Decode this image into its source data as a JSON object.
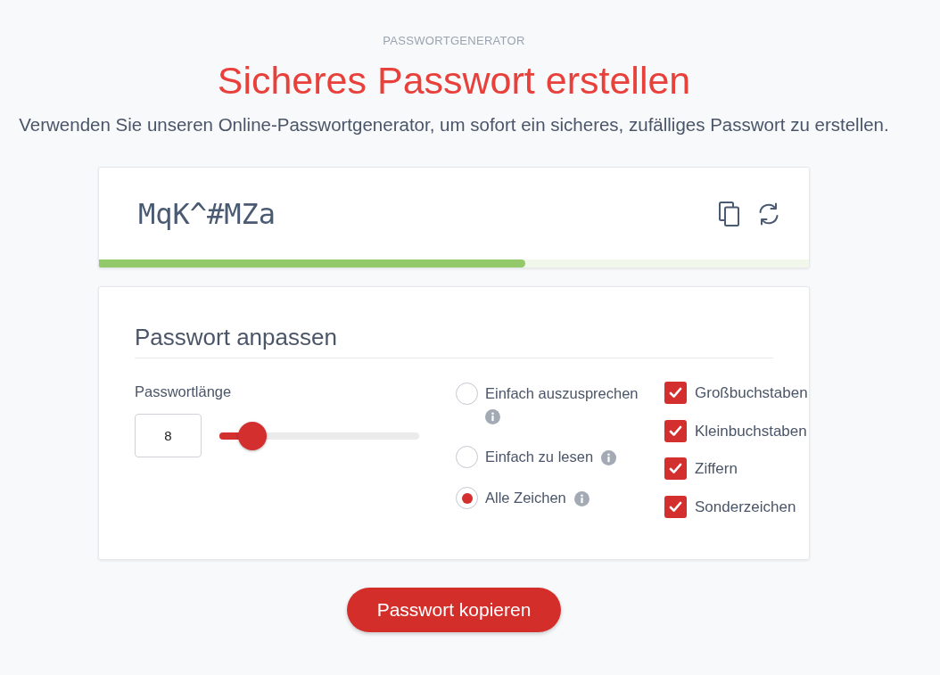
{
  "header": {
    "eyebrow": "PASSWORTGENERATOR",
    "title": "Sicheres Passwort erstellen",
    "subtitle": "Verwenden Sie unseren Online-Passwortgenerator, um sofort ein sicheres, zufälliges Passwort zu erstellen."
  },
  "password_card": {
    "password": "MqK^#MZa",
    "strength": {
      "level": 0.6
    }
  },
  "settings": {
    "title": "Passwort anpassen",
    "length": {
      "label": "Passwortlänge",
      "value": "8",
      "level": 0.165
    },
    "modes": [
      {
        "label": "Einfach auszusprechen",
        "selected": false
      },
      {
        "label": "Einfach zu lesen",
        "selected": false
      },
      {
        "label": "Alle Zeichen",
        "selected": true
      }
    ],
    "character_sets": [
      {
        "label": "Großbuchstaben",
        "checked": true
      },
      {
        "label": "Kleinbuchstaben",
        "checked": true
      },
      {
        "label": "Ziffern",
        "checked": true
      },
      {
        "label": "Sonderzeichen",
        "checked": true
      }
    ]
  },
  "copy_button": {
    "label": "Passwort kopieren"
  }
}
